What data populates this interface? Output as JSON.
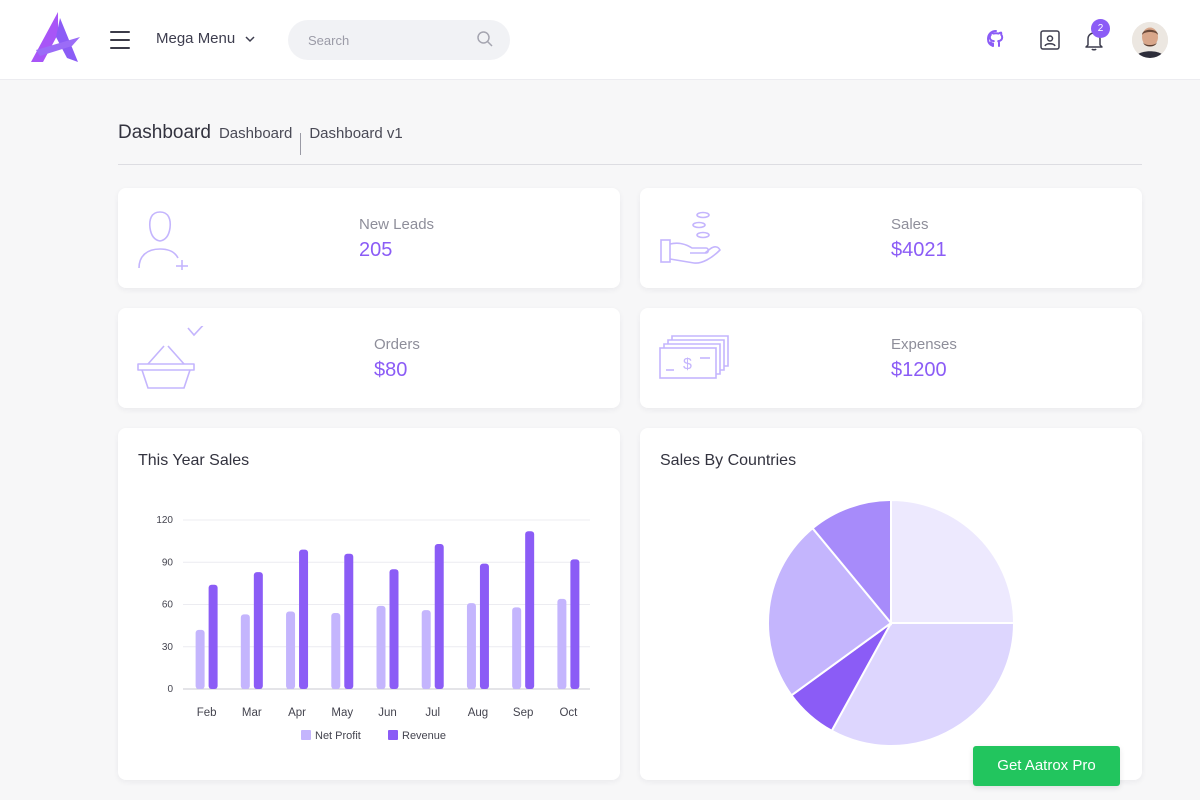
{
  "header": {
    "menu_label": "Mega Menu",
    "search_placeholder": "Search",
    "notification_count": "2"
  },
  "breadcrumb": {
    "title": "Dashboard",
    "items": [
      "Dashboard",
      "Dashboard v1"
    ]
  },
  "stats": {
    "new_leads": {
      "label": "New Leads",
      "value": "205"
    },
    "sales": {
      "label": "Sales",
      "value": "$4021"
    },
    "orders": {
      "label": "Orders",
      "value": "$80"
    },
    "expenses": {
      "label": "Expenses",
      "value": "$1200"
    }
  },
  "colors": {
    "accent": "#8b5cf6",
    "accent_light": "#c4b5fd",
    "cta": "#22c55e"
  },
  "cta_label": "Get Aatrox Pro",
  "chart_data": [
    {
      "type": "bar",
      "title": "This Year Sales",
      "categories": [
        "Feb",
        "Mar",
        "Apr",
        "May",
        "Jun",
        "Jul",
        "Aug",
        "Sep",
        "Oct"
      ],
      "series": [
        {
          "name": "Net Profit",
          "values": [
            42,
            53,
            55,
            54,
            59,
            56,
            61,
            58,
            64
          ],
          "color": "#c4b5fd"
        },
        {
          "name": "Revenue",
          "values": [
            74,
            83,
            99,
            96,
            85,
            103,
            89,
            112,
            92
          ],
          "color": "#8b5cf6"
        }
      ],
      "yticks": [
        0,
        30,
        60,
        90,
        120
      ],
      "ylim": [
        0,
        120
      ],
      "grid": true,
      "legend": "bottom"
    },
    {
      "type": "pie",
      "title": "Sales By Countries",
      "values": [
        25,
        33,
        7,
        24,
        11
      ],
      "colors": [
        "#ede9fe",
        "#ddd6fe",
        "#8b5cf6",
        "#c4b5fd",
        "#a78bfa"
      ]
    }
  ]
}
